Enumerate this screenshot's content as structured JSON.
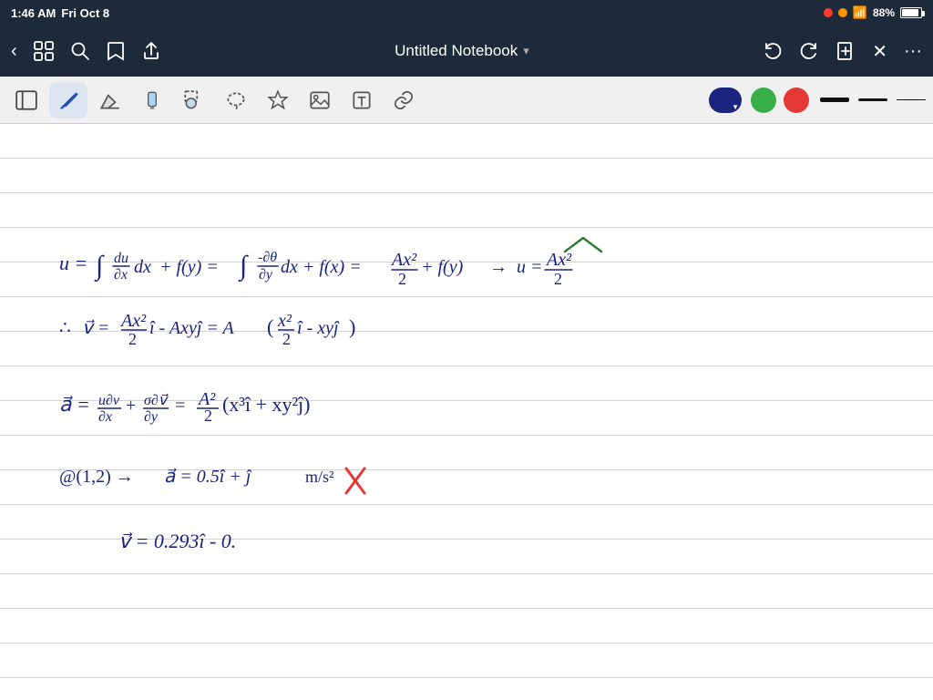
{
  "statusBar": {
    "time": "1:46 AM",
    "day": "Fri Oct 8",
    "battery": "88%",
    "wifi": true,
    "recording": true,
    "orange_dot": true
  },
  "toolbar": {
    "title": "Untitled Notebook",
    "chevron": "▾",
    "leftIcons": [
      "back",
      "grid",
      "search",
      "bookmark",
      "share"
    ],
    "rightIcons": [
      "undo",
      "redo",
      "new-page",
      "close",
      "more"
    ]
  },
  "drawingToolbar": {
    "tools": [
      {
        "name": "sidebar-toggle",
        "icon": "sidebar"
      },
      {
        "name": "pen-tool",
        "icon": "pen",
        "active": true
      },
      {
        "name": "eraser-tool",
        "icon": "eraser"
      },
      {
        "name": "highlighter-tool",
        "icon": "highlighter"
      },
      {
        "name": "selection-tool",
        "icon": "selection"
      },
      {
        "name": "lasso-tool",
        "icon": "lasso"
      },
      {
        "name": "star-tool",
        "icon": "star"
      },
      {
        "name": "image-tool",
        "icon": "image"
      },
      {
        "name": "text-tool",
        "icon": "text"
      },
      {
        "name": "link-tool",
        "icon": "link"
      }
    ],
    "colors": [
      {
        "name": "dark-blue",
        "hex": "#1a237e",
        "selected": true
      },
      {
        "name": "green",
        "hex": "#4caf50"
      },
      {
        "name": "red",
        "hex": "#f44336"
      }
    ],
    "lineWidths": [
      "thick",
      "medium",
      "thin"
    ]
  },
  "notebook": {
    "title": "Untitled Notebook",
    "content": "handwritten math equations"
  }
}
